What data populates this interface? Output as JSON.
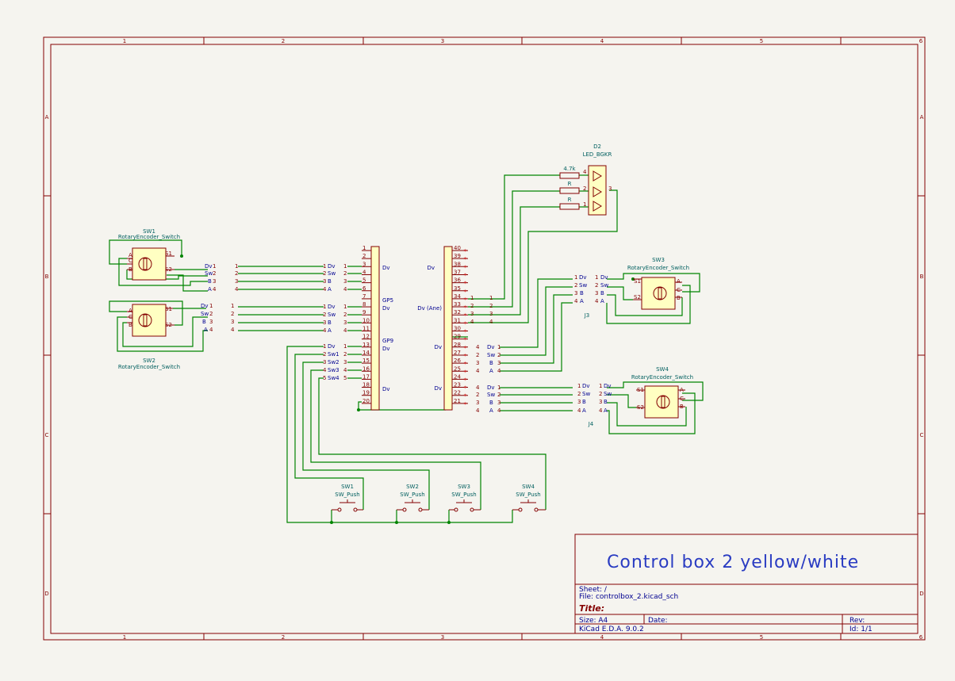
{
  "frame": {
    "columns": [
      "1",
      "2",
      "3",
      "4",
      "5",
      "6"
    ],
    "rows": [
      "A",
      "B",
      "C",
      "D"
    ]
  },
  "title_block": {
    "big_title": "Control box 2    yellow/white",
    "sheet": "Sheet: /",
    "file": "File: controlbox_2.kicad_sch",
    "title_label": "Title:",
    "size": "Size: A4",
    "date": "Date:",
    "rev": "Rev:",
    "tool": "KiCad E.D.A. 9.0.2",
    "id": "Id: 1/1"
  },
  "encoders": {
    "sw1": {
      "ref": "SW1",
      "value": "RotaryEncoder_Switch"
    },
    "sw2": {
      "ref": "SW2",
      "value": "RotaryEncoder_Switch"
    },
    "sw3": {
      "ref": "SW3",
      "value": "RotaryEncoder_Switch"
    },
    "sw4": {
      "ref": "SW4",
      "value": "RotaryEncoder_Switch"
    },
    "pins": {
      "a": "A",
      "c": "C",
      "b": "B",
      "s1": "S1",
      "s2": "S2"
    }
  },
  "led": {
    "ref": "D2",
    "value": "LED_BGKR",
    "r1": "4.7k",
    "r2": "R",
    "r3": "R"
  },
  "connectors": {
    "j3": "J3",
    "j4": "J4"
  },
  "push_buttons": [
    {
      "ref": "SW1",
      "value": "SW_Push"
    },
    {
      "ref": "SW2",
      "value": "SW_Push"
    },
    {
      "ref": "SW3",
      "value": "SW_Push"
    },
    {
      "ref": "SW4",
      "value": "SW_Push"
    }
  ],
  "left_header_labels": {
    "p3": "Dv",
    "p7": "GP5",
    "p8": "Dv",
    "p11": "GP9",
    "p14": "Dv",
    "p19": "Dv"
  },
  "right_header_labels": {
    "p38": "Dv",
    "p33": "Dv (Ane)",
    "p28": "Dv",
    "p23": "Dv"
  },
  "nets": {
    "dv": "Dv",
    "sw": "Sw",
    "b": "B",
    "a": "A",
    "sw1": "Sw1",
    "sw2": "Sw2",
    "sw3": "Sw3",
    "sw4": "Sw4"
  }
}
